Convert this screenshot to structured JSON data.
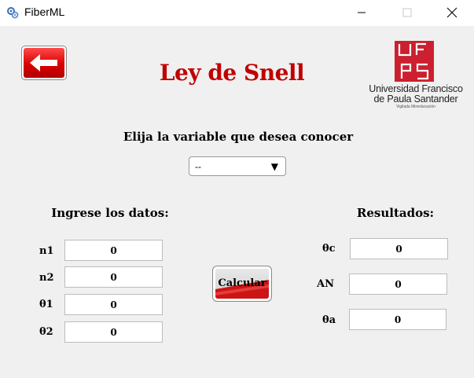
{
  "window": {
    "title": "FiberML",
    "app_icon": "gear-icon"
  },
  "header": {
    "title": "Ley de Snell",
    "back_icon": "arrow-left-icon",
    "logo": {
      "line1": "Universidad Francisco",
      "line2": "de Paula Santander",
      "line3": "Vigilada Mineducación",
      "mark_letters": "UFPS"
    }
  },
  "variable_select": {
    "prompt": "Elija la variable que desea conocer",
    "selected": "--"
  },
  "inputs": {
    "title": "Ingrese los datos:",
    "fields": [
      {
        "label": "n1",
        "value": "0"
      },
      {
        "label": "n2",
        "value": "0"
      },
      {
        "label": "θ1",
        "value": "0"
      },
      {
        "label": "θ2",
        "value": "0"
      }
    ]
  },
  "calculate_label": "Calcular",
  "results": {
    "title": "Resultados:",
    "fields": [
      {
        "label": "θc",
        "value": "0"
      },
      {
        "label": "AN",
        "value": "0"
      },
      {
        "label": "θa",
        "value": "0"
      }
    ]
  },
  "colors": {
    "title_red": "#c00000",
    "brand_red": "#cc1f2f",
    "background": "#f0f0f0"
  }
}
